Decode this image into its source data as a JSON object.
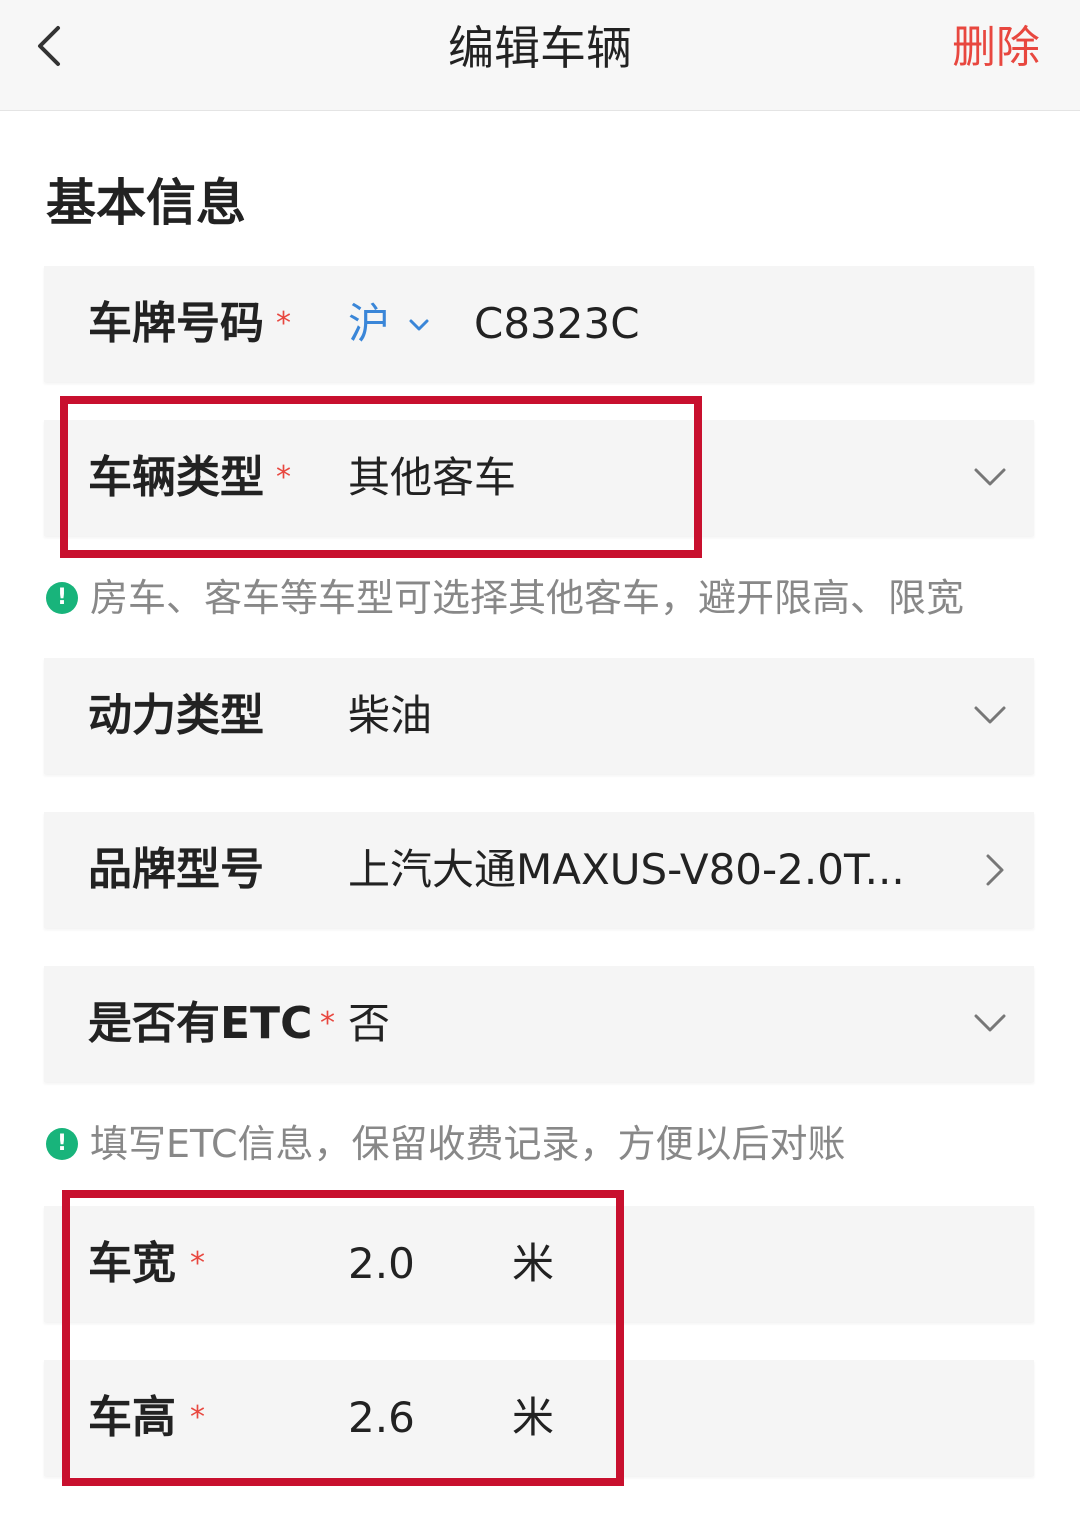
{
  "header": {
    "title": "编辑车辆",
    "delete_label": "删除"
  },
  "section": {
    "title": "基本信息"
  },
  "plate": {
    "label": "车牌号码",
    "required": "*",
    "province": "沪",
    "number": "C8323C"
  },
  "vehicle_type": {
    "label": "车辆类型",
    "required": "*",
    "value": "其他客车"
  },
  "hint_vehicle": {
    "icon": "!",
    "text": "房车、客车等车型可选择其他客车，避开限高、限宽"
  },
  "power_type": {
    "label": "动力类型",
    "value": "柴油"
  },
  "brand_model": {
    "label": "品牌型号",
    "value": "上汽大通MAXUS-V80-2.0T..."
  },
  "etc": {
    "label": "是否有ETC",
    "required": "*",
    "value": "否"
  },
  "hint_etc": {
    "icon": "!",
    "text": "填写ETC信息，保留收费记录，方便以后对账"
  },
  "width": {
    "label": "车宽",
    "required": "*",
    "value": "2.0",
    "unit": "米"
  },
  "height": {
    "label": "车高",
    "required": "*",
    "value": "2.6",
    "unit": "米"
  },
  "colors": {
    "accent_red": "#e8473f",
    "province_blue": "#3a86d8",
    "hint_green": "#18b47b",
    "highlight_red": "#c8102e"
  },
  "icons": [
    "back-icon",
    "chevron-down-icon",
    "chevron-right-icon",
    "info-icon"
  ]
}
